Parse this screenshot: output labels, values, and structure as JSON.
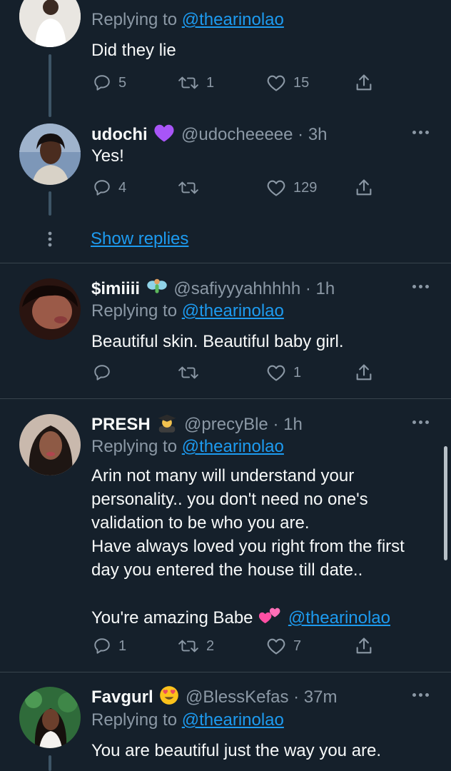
{
  "tweets": [
    {
      "replying_prefix": "Replying to",
      "replying_to": "@thearinolao",
      "text": "Did they lie",
      "replies": "5",
      "retweets": "1",
      "likes": "15"
    },
    {
      "name": "udochi",
      "handle_time": "@udocheeeee · 3h",
      "text": "Yes!",
      "replies": "4",
      "retweets": "",
      "likes": "129"
    },
    {
      "name": "$imiiii",
      "handle_time": "@safiyyyahhhhh · 1h",
      "replying_prefix": "Replying to",
      "replying_to": "@thearinolao",
      "text": "Beautiful skin. Beautiful baby girl.",
      "replies": "",
      "retweets": "",
      "likes": "1"
    },
    {
      "name": "PRESH",
      "handle_time": "@precyBle · 1h",
      "replying_prefix": "Replying to",
      "replying_to": "@thearinolao",
      "text_lines": [
        "Arin not many will understand your",
        "personality.. you don't need no one's",
        "validation to be who you are.",
        "Have always loved you right from the first",
        "day you entered the house till date.."
      ],
      "text_last": "You're amazing Babe",
      "text_last_mention": "@thearinolao",
      "replies": "1",
      "retweets": "2",
      "likes": "7"
    },
    {
      "name": "Favgurl",
      "handle_time": "@BlessKefas · 37m",
      "replying_prefix": "Replying to",
      "replying_to": "@thearinolao",
      "text": "You are beautiful just the way you are."
    }
  ],
  "show_replies": "Show replies",
  "icons": {
    "reply": "reply-icon",
    "retweet": "retweet-icon",
    "like": "heart-icon",
    "share": "share-icon",
    "more": "more-icon"
  },
  "colors": {
    "background": "#15202b",
    "link": "#1d9bf0",
    "muted": "#8b98a5",
    "text": "#f7f9f9",
    "divider": "#38444d"
  }
}
